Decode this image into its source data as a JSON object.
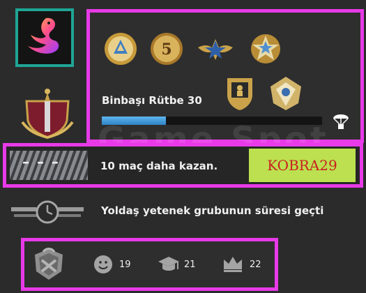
{
  "rank": {
    "title": "Binbaşı Rütbe 30",
    "xp_progress": 0.29
  },
  "win_prompt": {
    "dashes": "– – –",
    "message": "10 maç daha kazan."
  },
  "promo_code": "KOBRA29",
  "cooldown": {
    "message": "Yoldaş yetenek grubunun süresi geçti"
  },
  "commendations": {
    "friendly": "19",
    "teacher": "21",
    "leader": "22"
  },
  "watermark": "Game Spot",
  "icons": [
    "swan-avatar-icon",
    "faction-crest-icon",
    "service-medal-icon",
    "five-year-coin-icon",
    "star-wings-medal-icon",
    "star-medal-icon",
    "soldier-medal-icon",
    "fan-medal-icon",
    "care-package-icon",
    "cooldown-clock-icon",
    "rank-insignia-icon",
    "friendly-icon",
    "teacher-icon",
    "leader-icon"
  ],
  "colors": {
    "highlight": "#e83ae8",
    "xp_bar": "#3b97da",
    "promo_bg": "#bce04f",
    "promo_text": "#c92020",
    "avatar_border": "#1fa595"
  }
}
